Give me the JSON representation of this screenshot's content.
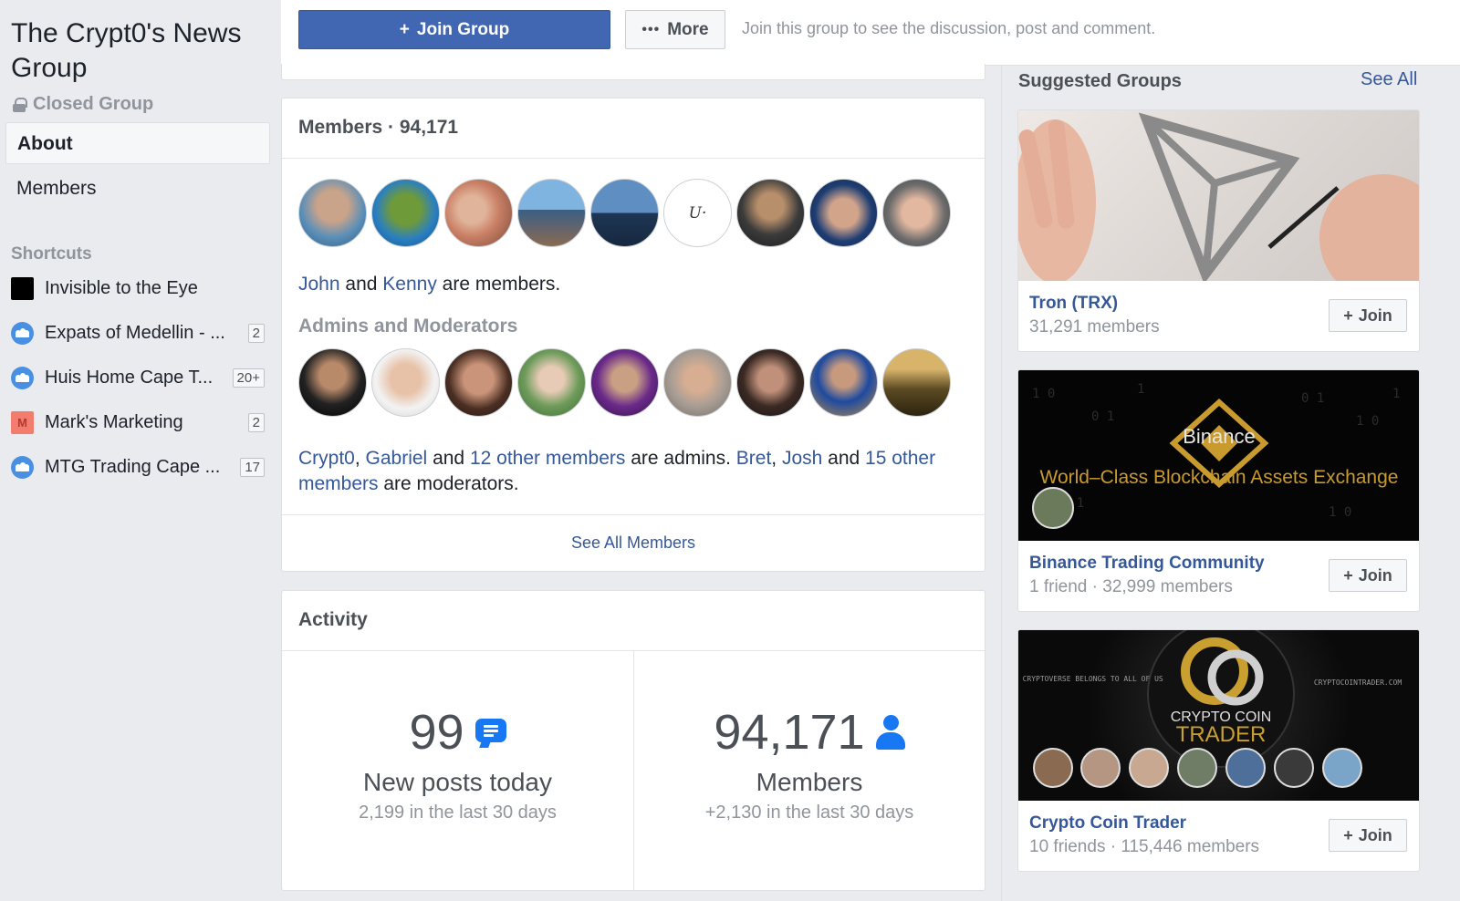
{
  "group": {
    "title": "The Crypt0's News Group",
    "privacy": "Closed Group"
  },
  "nav": {
    "about": "About",
    "members": "Members"
  },
  "shortcuts": {
    "heading": "Shortcuts",
    "items": [
      {
        "label": "Invisible to the Eye",
        "badge": "",
        "icon": "page-thumbnail"
      },
      {
        "label": "Expats of Medellin - ...",
        "badge": "2",
        "icon": "group-icon"
      },
      {
        "label": "Huis Home Cape T...",
        "badge": "20+",
        "icon": "group-icon"
      },
      {
        "label": "Mark's Marketing",
        "badge": "2",
        "icon": "letter-m-icon",
        "letter": "M"
      },
      {
        "label": "MTG Trading Cape ...",
        "badge": "17",
        "icon": "group-icon"
      }
    ]
  },
  "topbar": {
    "join_label": "Join Group",
    "more_label": "More",
    "join_note": "Join this group to see the discussion, post and comment."
  },
  "members_card": {
    "title": "Members · 94,171",
    "member_line": {
      "a": "John",
      "and": "and",
      "b": "Kenny",
      "rest": "are members."
    },
    "admins_heading": "Admins and Moderators",
    "admin_line": {
      "a": "Crypt0",
      "sep1": ", ",
      "b": "Gabriel",
      "and1": " and ",
      "c": "12 other members",
      "mid": " are admins. ",
      "d": "Bret",
      "sep2": ", ",
      "e": "Josh",
      "and2": " and ",
      "f": "15 other members",
      "end": " are moderators."
    },
    "see_all": "See All Members"
  },
  "activity": {
    "title": "Activity",
    "posts": {
      "value": "99",
      "label": "New posts today",
      "sub": "2,199 in the last 30 days"
    },
    "members": {
      "value": "94,171",
      "label": "Members",
      "sub": "+2,130 in the last 30 days"
    }
  },
  "suggested": {
    "heading": "Suggested Groups",
    "see_all": "See All",
    "join_label": "Join",
    "groups": [
      {
        "name": "Tron (TRX)",
        "meta": "31,291 members"
      },
      {
        "name": "Binance Trading Community",
        "meta": "1 friend · 32,999 members",
        "image_text_a": "Binance",
        "image_text_b": "World–Class Blockchain Assets Exchange"
      },
      {
        "name": "Crypto Coin Trader",
        "meta": "10 friends · 115,446 members",
        "image_text_a": "THE CRYPTOVERSE BELONGS TO ALL OF US",
        "image_text_b": "CRYPTOCOINTRADER.COM",
        "image_text_c": "CRYPTO COIN",
        "image_text_d": "TRADER"
      }
    ]
  },
  "colors": {
    "brand_blue": "#4267b2",
    "link": "#365899",
    "accent_icon": "#1877f2",
    "muted": "#90949c"
  }
}
